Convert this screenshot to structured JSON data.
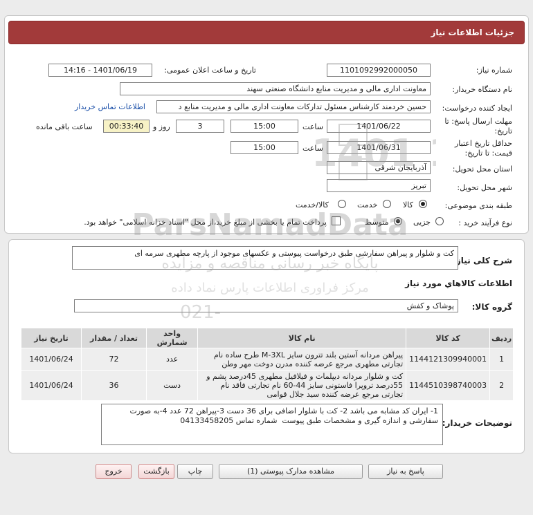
{
  "header": {
    "title": "جزئیات اطلاعات نیاز"
  },
  "form": {
    "need_number_label": "شماره نیاز:",
    "need_number": "1101092992000050",
    "announce_label": "تاریخ و ساعت اعلان عمومی:",
    "announce_value": "1401/06/19 - 14:16",
    "buyer_label": "نام دستگاه خریدار:",
    "buyer_value": "معاونت اداری  مالی و مدیریت منابع دانشگاه صنعتی سهند",
    "creator_label": "ایجاد کننده درخواست:",
    "creator_value": "حسین خردمند کارشناس مسئول تدارکات معاونت اداری  مالی و مدیریت منابع د",
    "contact_link": "اطلاعات تماس خریدار",
    "reply_label_1": "مهلت ارسال پاسخ: تا",
    "reply_label_2": "تاریخ:",
    "reply_date": "1401/06/22",
    "time_label": "ساعت",
    "reply_time": "15:00",
    "days_value": "3",
    "days_label": "روز و",
    "remaining_value": "00:33:40",
    "remaining_label": "ساعت باقی مانده",
    "validity_label_1": "حداقل تاریخ اعتبار",
    "validity_label_2": "قیمت: تا تاریخ:",
    "validity_date": "1401/06/31",
    "validity_time": "15:00",
    "province_label": "استان محل تحویل:",
    "province_value": "آذربایجان شرقی",
    "city_label": "شهر محل تحویل:",
    "city_value": "تبریز",
    "category_label": "طبقه بندی موضوعی:",
    "category_options": [
      "کالا",
      "خدمت",
      "کالا/خدمت"
    ],
    "purchase_label": "نوع فرآیند خرید :",
    "purchase_options": [
      "جزیی",
      "متوسط"
    ],
    "treasury_text": "پرداخت تمام یا بخشی از مبلغ خرید،از محل \"اسناد خزانه اسلامی\" خواهد بود."
  },
  "summary": {
    "label": "شرح کلی نیاز:",
    "value": "کت و شلوار و پیراهن سفارشی طبق درخواست پیوستی و عکسهای موجود از پارچه مطهری سرمه ای"
  },
  "goods": {
    "section_title": "اطلاعات کالاهاي مورد نياز",
    "group_label": "گروه کالا:",
    "group_value": "پوشاک و کفش",
    "columns": [
      "ردیف",
      "کد کالا",
      "نام کالا",
      "واحد شمارش",
      "تعداد / مقدار",
      "تاریخ نیاز"
    ],
    "rows": [
      {
        "index": "1",
        "code": "1144121309940001",
        "name": "پیراهن مردانه آستین بلند تترون سایز M-3XL طرح ساده نام تجارتی مطهری مرجع عرضه کننده مدرن دوخت مهر وطن",
        "unit": "عدد",
        "qty": "72",
        "date": "1401/06/24"
      },
      {
        "index": "2",
        "code": "1144510398740003",
        "name": "کت و شلوار مردانه دیپلمات و فیلافیل مطهری 45درصد پشم و 55درصد تروپرا فاستونی سایز 44-60 نام تجارتی فاقد نام تجارتی مرجع عرضه کننده سید جلال قوامی",
        "unit": "دست",
        "qty": "36",
        "date": "1401/06/24"
      }
    ]
  },
  "notes": {
    "label": "توضیحات خریدار:",
    "value": "1- ایران کد مشابه می باشد 2- کت با شلوار اضافی برای 36 دست 3-پیراهن 72 عدد 4-به صورت سفارشی و اندازه گیری و مشخصات طبق پیوست  شماره تماس 04133458205"
  },
  "buttons": {
    "reply": "پاسخ به نیاز",
    "attachments": "مشاهده مدارک پیوستی (1)",
    "print": "چاپ",
    "back": "بازگشت",
    "exit": "خروج"
  },
  "watermark": {
    "brand": "ParsNamadData",
    "line1": "پایگاه خبر رسانی مناقصه و مزایده",
    "line2": "مرکز فراوری اطلاعات پارس نماد داده",
    "phone": "021-",
    "year": "1401 10"
  },
  "colors": {
    "header": "#a23a3a",
    "link": "#1a4fa8",
    "remaining_bg": "#f7f2c6"
  }
}
